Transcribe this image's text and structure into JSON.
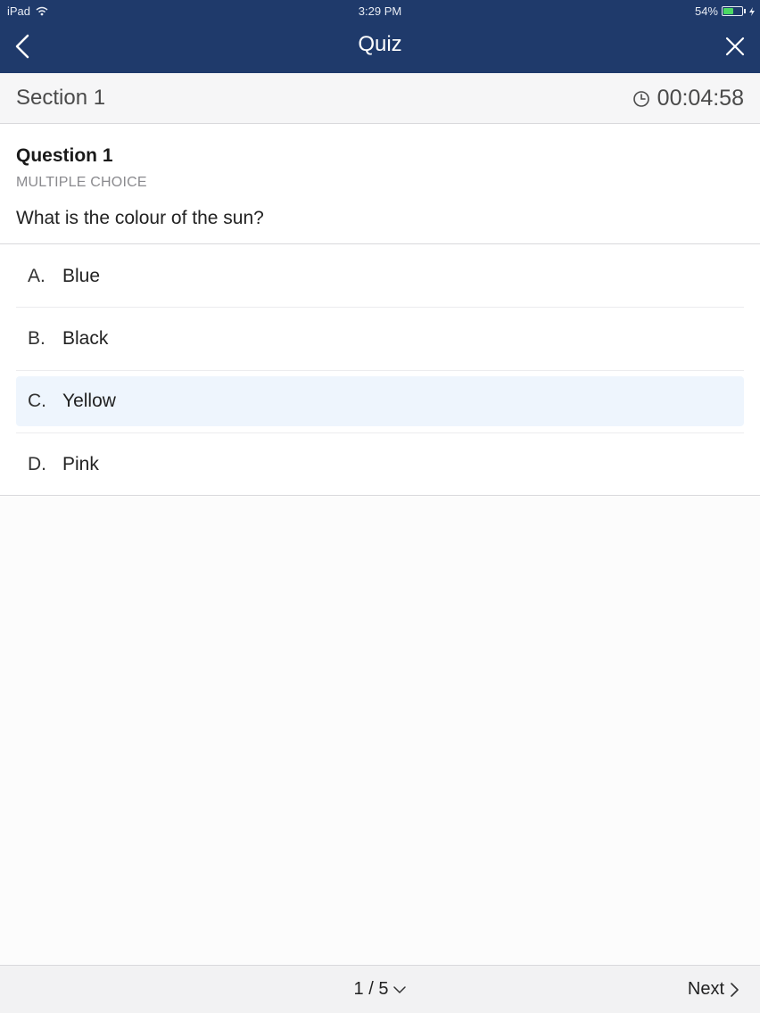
{
  "status_bar": {
    "device": "iPad",
    "time": "3:29 PM",
    "battery": "54%",
    "battery_level": 0.54,
    "battery_color": "#4cd964"
  },
  "nav": {
    "title": "Quiz",
    "background": "#1f3a6b"
  },
  "section": {
    "title": "Section 1",
    "timer": "00:04:58"
  },
  "question": {
    "title": "Question 1",
    "type": "MULTIPLE CHOICE",
    "text": "What is the colour of the sun?"
  },
  "options": [
    {
      "letter": "A.",
      "text": "Blue",
      "selected": false
    },
    {
      "letter": "B.",
      "text": "Black",
      "selected": false
    },
    {
      "letter": "C.",
      "text": "Yellow",
      "selected": true
    },
    {
      "letter": "D.",
      "text": "Pink",
      "selected": false
    }
  ],
  "selected_highlight": "#eef5fd",
  "footer": {
    "pager": "1 / 5",
    "next_label": "Next"
  }
}
